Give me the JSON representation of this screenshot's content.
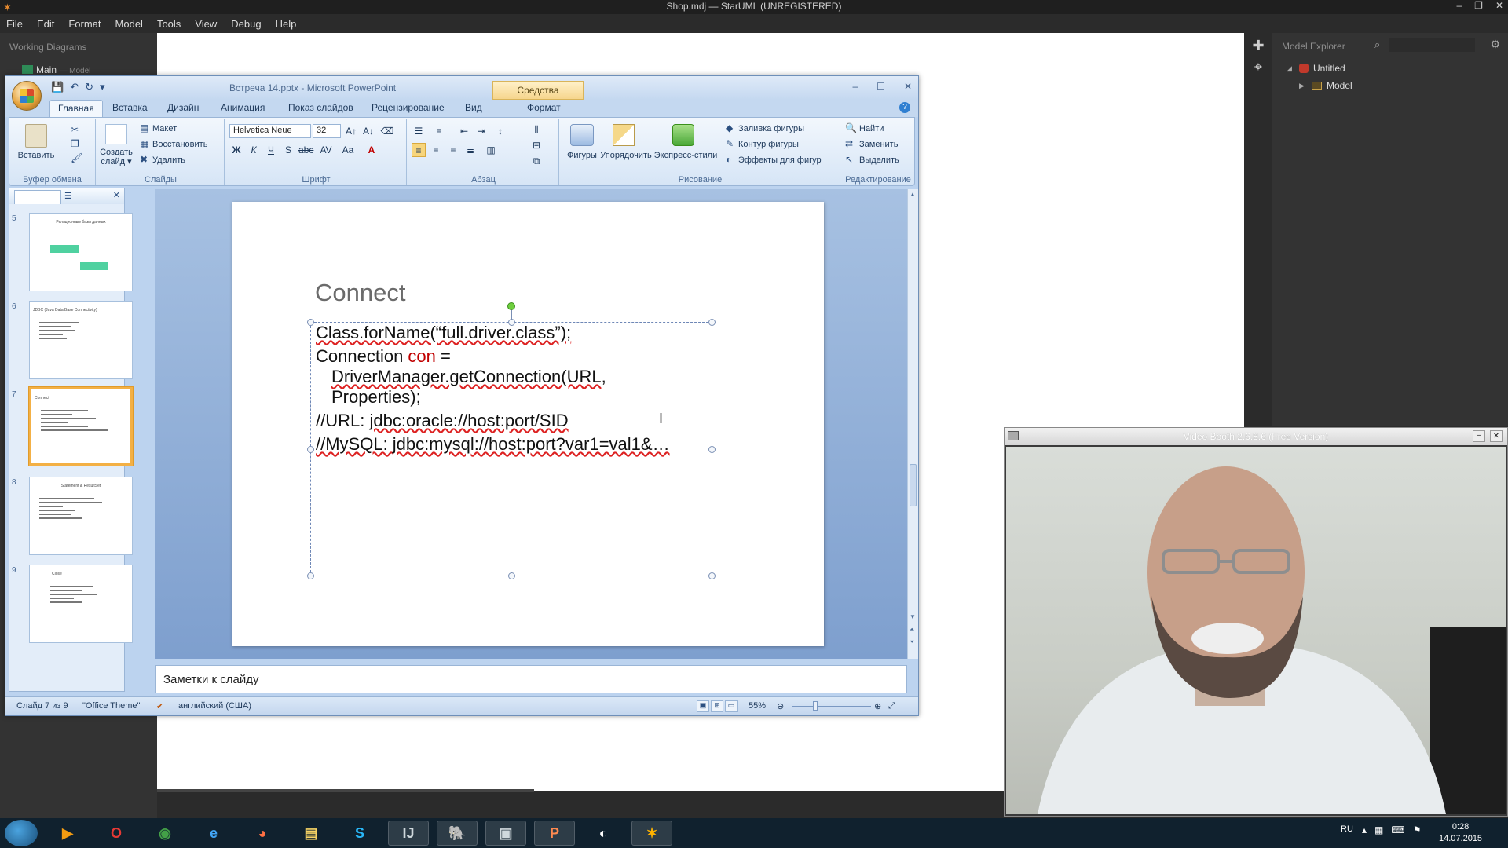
{
  "staruml": {
    "title": "Shop.mdj — StarUML (UNREGISTERED)",
    "menu": [
      "File",
      "Edit",
      "Format",
      "Model",
      "Tools",
      "View",
      "Debug",
      "Help"
    ],
    "working_diagrams": "Working Diagrams",
    "main_diagram": "Main",
    "main_diagram_sub": "— Model",
    "model_explorer": "Model Explorer",
    "tree": {
      "project": "Untitled",
      "model": "Model"
    }
  },
  "ppt": {
    "title": "Встреча 14.pptx - Microsoft PowerPoint",
    "drawing_tools": "Средства рисования",
    "tabs": [
      "Главная",
      "Вставка",
      "Дизайн",
      "Анимация",
      "Показ слайдов",
      "Рецензирование",
      "Вид",
      "Формат"
    ],
    "ribbon": {
      "paste": "Вставить",
      "clipboard_group": "Буфер обмена",
      "new_slide_1": "Создать",
      "new_slide_2": "слайд",
      "layout": "Макет",
      "reset": "Восстановить",
      "delete": "Удалить",
      "slides_group": "Слайды",
      "font_name": "Helvetica Neue",
      "font_size": "32",
      "font_group": "Шрифт",
      "paragraph_group": "Абзац",
      "shapes": "Фигуры",
      "arrange": "Упорядочить",
      "quick_styles": "Экспресс-стили",
      "shape_fill": "Заливка фигуры",
      "shape_outline": "Контур фигуры",
      "shape_effects": "Эффекты для фигур",
      "drawing_group": "Рисование",
      "find": "Найти",
      "replace": "Заменить",
      "select": "Выделить",
      "editing_group": "Редактирование"
    },
    "thumbnails": [
      {
        "num": "5",
        "title": "Реляционные базы данных"
      },
      {
        "num": "6",
        "title": "JDBC (Java Data Base Connectivity)"
      },
      {
        "num": "7",
        "title": "Connect"
      },
      {
        "num": "8",
        "title": "Statement & ResultSet"
      },
      {
        "num": "9",
        "title": "Close"
      }
    ],
    "slide": {
      "title": "Connect",
      "line1": "Class.forName(“full.driver.class”);",
      "line2a": "Connection ",
      "line2b": "con",
      "line2c": " =",
      "line3": "DriverManager.getConnection(URL,",
      "line4": "Properties);",
      "line5a": "//URL: ",
      "line5b": "jdbc:oracle://host:port/SID",
      "line6a": "//MySQL: ",
      "line6b": "jdbc:mysql://host:port?var1=val1&…"
    },
    "notes_placeholder": "Заметки к слайду",
    "status": {
      "slide": "Слайд 7 из 9",
      "theme": "\"Office Theme\"",
      "language": "английский (США)",
      "zoom": "55%"
    }
  },
  "video_booth": {
    "title": "Video Booth 2.6.8.6 (Free Version)"
  },
  "taskbar": {
    "lang": "RU",
    "time": "0:28",
    "date": "14.07.2015"
  }
}
